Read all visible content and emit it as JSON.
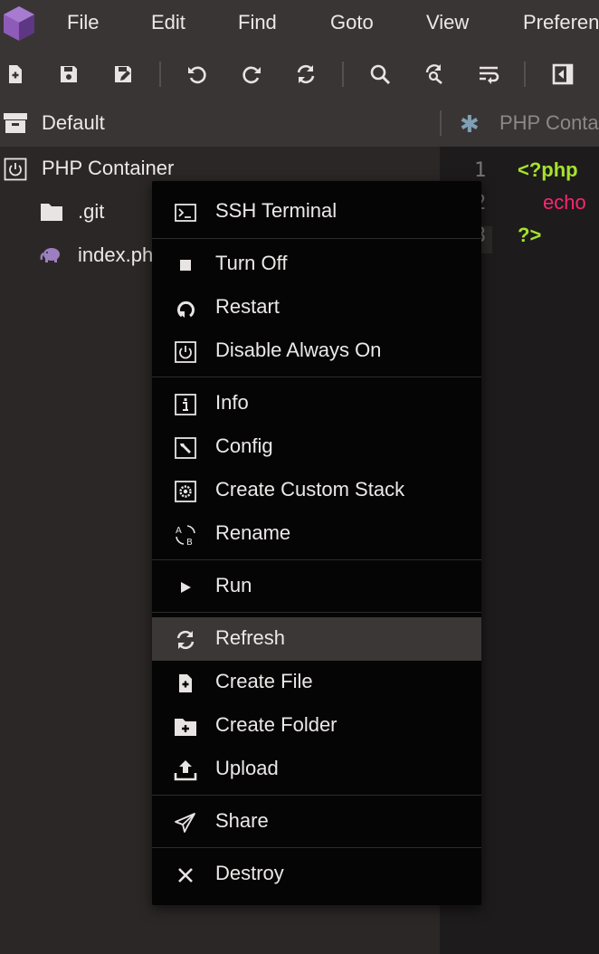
{
  "menubar": {
    "items": [
      "File",
      "Edit",
      "Find",
      "Goto",
      "View",
      "Preferen"
    ]
  },
  "toolbar": {
    "buttons": [
      "new-file-icon",
      "save-icon",
      "save-as-icon",
      "undo-icon",
      "redo-icon",
      "refresh-icon",
      "search-icon",
      "search-replace-icon",
      "word-wrap-icon",
      "toggle-panel-icon"
    ]
  },
  "sidebar": {
    "stack_title": "Default",
    "container_name": "PHP Container",
    "files": [
      {
        "name": ".git",
        "icon": "folder-icon"
      },
      {
        "name": "index.ph",
        "icon": "php-elephant-icon"
      }
    ]
  },
  "editor": {
    "tab_label": "PHP Conta",
    "line_numbers": [
      "1",
      "2",
      "3"
    ],
    "lines": [
      "<?php",
      "echo",
      "?>"
    ]
  },
  "context_menu": {
    "groups": [
      [
        {
          "label": "SSH Terminal",
          "icon": "terminal-icon"
        }
      ],
      [
        {
          "label": "Turn Off",
          "icon": "stop-icon"
        },
        {
          "label": "Restart",
          "icon": "restart-icon"
        },
        {
          "label": "Disable Always On",
          "icon": "power-icon"
        }
      ],
      [
        {
          "label": "Info",
          "icon": "info-icon"
        },
        {
          "label": "Config",
          "icon": "wrench-icon"
        },
        {
          "label": "Create Custom Stack",
          "icon": "gear-icon"
        },
        {
          "label": "Rename",
          "icon": "rename-icon"
        }
      ],
      [
        {
          "label": "Run",
          "icon": "play-icon"
        }
      ],
      [
        {
          "label": "Refresh",
          "icon": "refresh-icon",
          "active": true
        },
        {
          "label": "Create File",
          "icon": "new-file-icon"
        },
        {
          "label": "Create Folder",
          "icon": "new-folder-icon"
        },
        {
          "label": "Upload",
          "icon": "upload-icon"
        }
      ],
      [
        {
          "label": "Share",
          "icon": "share-icon"
        }
      ],
      [
        {
          "label": "Destroy",
          "icon": "close-icon"
        }
      ]
    ]
  },
  "colors": {
    "background": "#2b2727",
    "panel": "#3a3535",
    "editor_bg": "#1d1b1b",
    "menu_bg": "#050505",
    "menu_active": "#3b3737",
    "php_tag": "#a6e22e",
    "keyword": "#f92672",
    "logo": "#8e5bb8"
  }
}
